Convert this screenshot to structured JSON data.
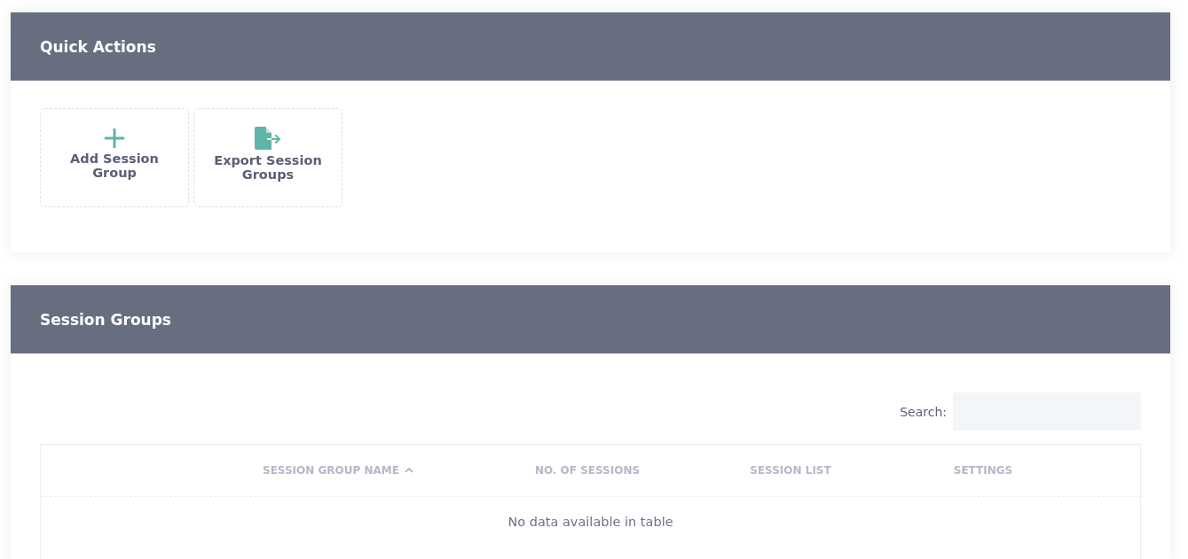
{
  "quick_actions": {
    "title": "Quick Actions",
    "actions": [
      {
        "kind": "add",
        "label": "Add Session Group"
      },
      {
        "kind": "export",
        "label": "Export Session Groups"
      }
    ]
  },
  "session_groups": {
    "title": "Session Groups",
    "search": {
      "label": "Search:"
    },
    "table": {
      "columns": [
        {
          "label": "SESSION GROUP NAME",
          "sorted": true
        },
        {
          "label": "NO. OF SESSIONS",
          "sorted": false
        },
        {
          "label": "SESSION LIST",
          "sorted": false
        },
        {
          "label": "SETTINGS",
          "sorted": false
        }
      ],
      "empty_message": "No data available in table"
    }
  }
}
